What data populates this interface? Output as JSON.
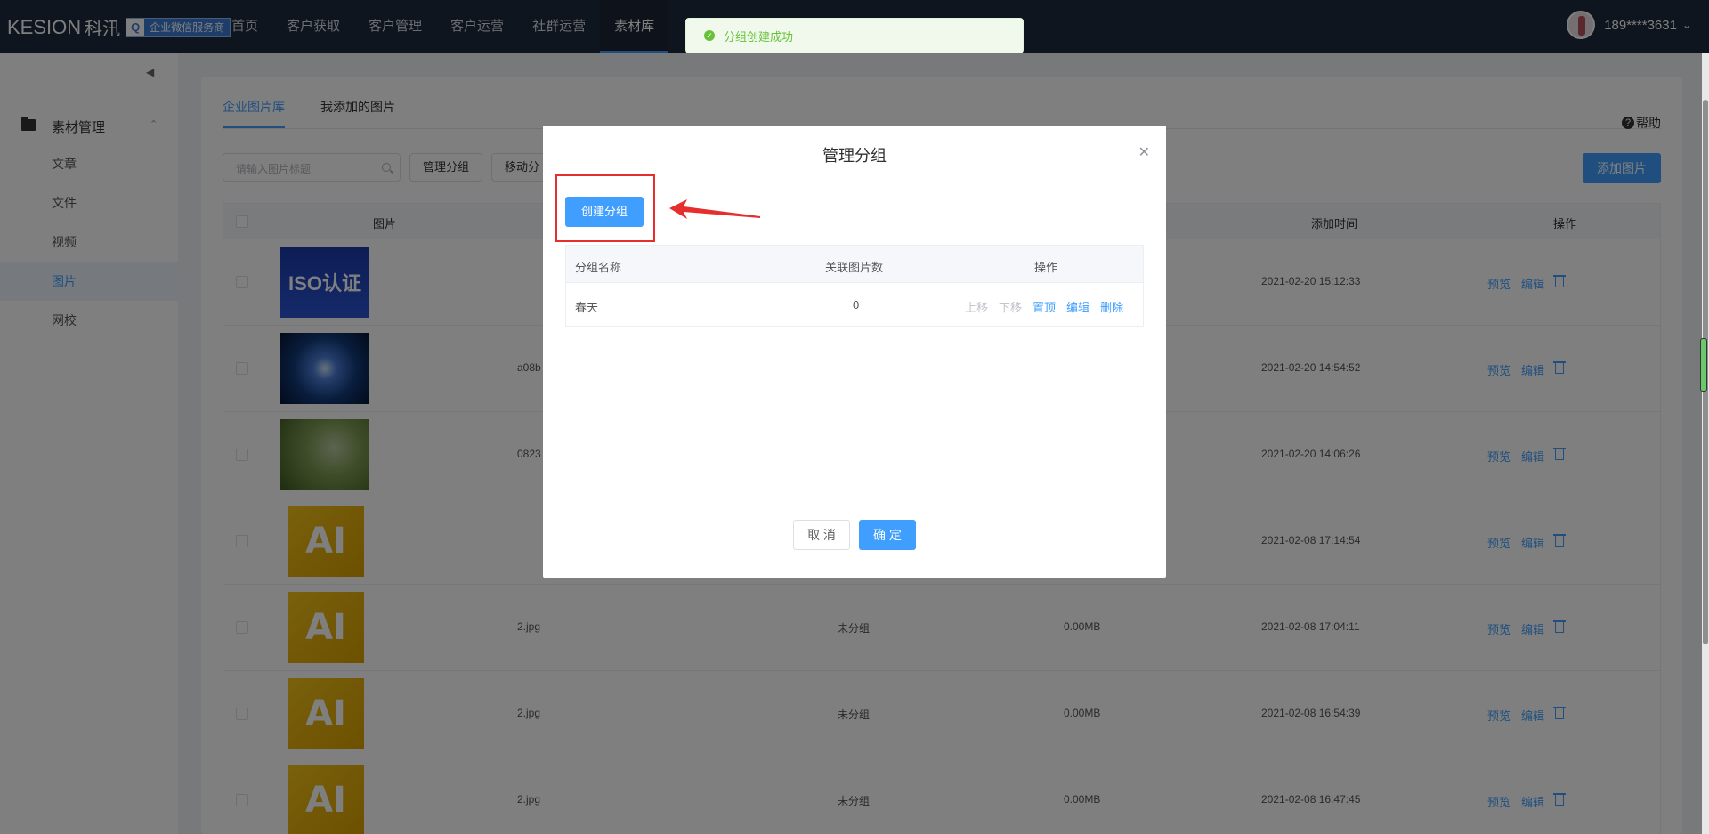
{
  "header": {
    "logo_text": "KESION",
    "logo_cn": "科汛",
    "logo_badge": "企业微信服务商",
    "nav": [
      "首页",
      "客户获取",
      "客户管理",
      "客户运营",
      "社群运营",
      "素材库"
    ],
    "active_nav": "素材库",
    "user_name": "189****3631"
  },
  "sidebar": {
    "group_label": "素材管理",
    "items": [
      {
        "label": "文章"
      },
      {
        "label": "文件"
      },
      {
        "label": "视频"
      },
      {
        "label": "图片"
      },
      {
        "label": "网校"
      }
    ],
    "active_item": "图片"
  },
  "main": {
    "tabs": [
      "企业图片库",
      "我添加的图片"
    ],
    "help_label": "帮助",
    "search_placeholder": "请输入图片标题",
    "manage_group_btn": "管理分组",
    "move_group_btn": "移动分",
    "add_image_btn": "添加图片",
    "columns": {
      "image": "图片",
      "add_time": "添加时间",
      "ops": "操作"
    },
    "rows": [
      {
        "thumb": "iso",
        "thumb_text": "ISO认证",
        "name": "",
        "group": "",
        "size": "",
        "time": "2021-02-20 15:12:33"
      },
      {
        "thumb": "galaxy",
        "thumb_text": "",
        "name": "a08b",
        "group": "",
        "size": "",
        "time": "2021-02-20 14:54:52"
      },
      {
        "thumb": "bird",
        "thumb_text": "",
        "name": "0823",
        "group": "",
        "size": "",
        "time": "2021-02-20 14:06:26"
      },
      {
        "thumb": "ai",
        "thumb_text": "AI",
        "name": "",
        "group": "",
        "size": "",
        "time": "2021-02-08 17:14:54"
      },
      {
        "thumb": "ai",
        "thumb_text": "AI",
        "name": "2.jpg",
        "group": "未分组",
        "size": "0.00MB",
        "time": "2021-02-08 17:04:11"
      },
      {
        "thumb": "ai",
        "thumb_text": "AI",
        "name": "2.jpg",
        "group": "未分组",
        "size": "0.00MB",
        "time": "2021-02-08 16:54:39"
      },
      {
        "thumb": "ai",
        "thumb_text": "AI",
        "name": "2.jpg",
        "group": "未分组",
        "size": "0.00MB",
        "time": "2021-02-08 16:47:45"
      }
    ],
    "row_ops": {
      "preview": "预览",
      "edit": "编辑"
    }
  },
  "toast": {
    "message": "分组创建成功"
  },
  "modal": {
    "title": "管理分组",
    "create_btn": "创建分组",
    "columns": {
      "name": "分组名称",
      "count": "关联图片数",
      "ops": "操作"
    },
    "groups": [
      {
        "name": "春天",
        "count": "0"
      }
    ],
    "group_ops": {
      "up": "上移",
      "down": "下移",
      "top": "置顶",
      "edit": "编辑",
      "delete": "删除"
    },
    "cancel_btn": "取 消",
    "ok_btn": "确 定"
  },
  "colors": {
    "primary": "#409eff",
    "topbar": "#1f2a3d",
    "highlight": "#e62e2e",
    "success": "#67c23a"
  }
}
